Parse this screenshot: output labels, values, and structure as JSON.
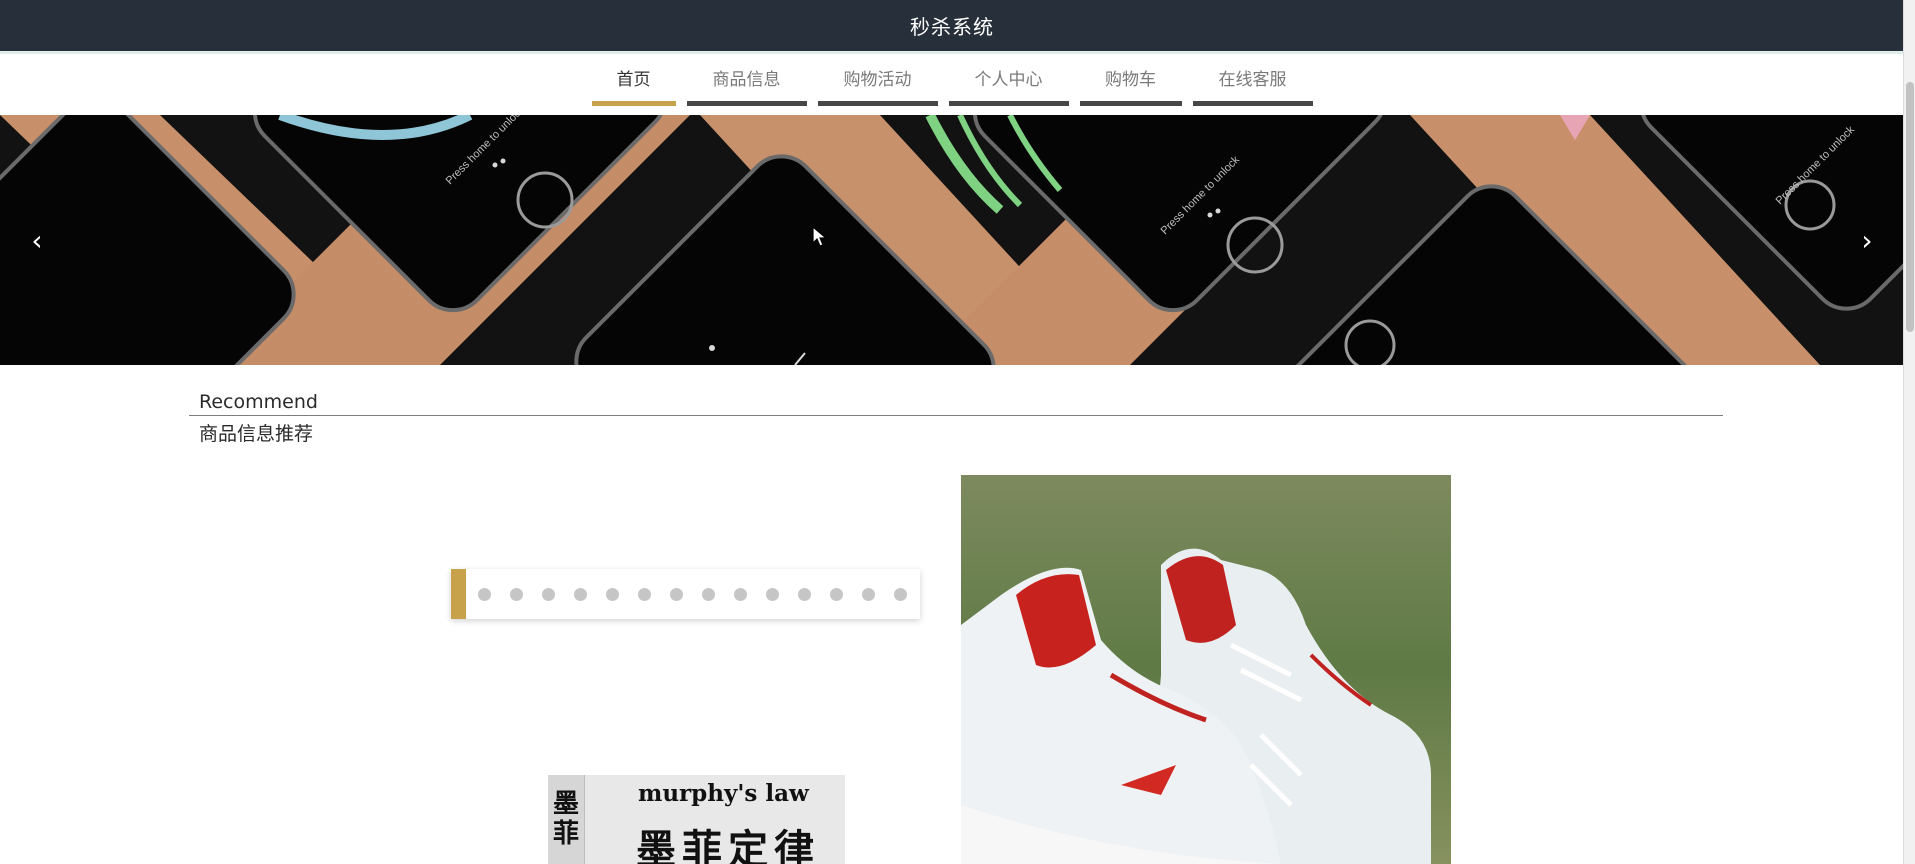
{
  "app": {
    "title": "秒杀系统"
  },
  "nav": {
    "items": [
      {
        "label": "首页",
        "active": true
      },
      {
        "label": "商品信息",
        "active": false
      },
      {
        "label": "购物活动",
        "active": false
      },
      {
        "label": "个人中心",
        "active": false
      },
      {
        "label": "购物车",
        "active": false
      },
      {
        "label": "在线客服",
        "active": false
      }
    ]
  },
  "banner": {
    "prev_icon": "‹",
    "next_icon": "›",
    "phone_lock_text": "Press home to unlock"
  },
  "recommend": {
    "title_en": "Recommend",
    "title_cn": "商品信息推荐"
  },
  "pager": {
    "dot_count": 14
  },
  "products": [
    {
      "name": "shoe",
      "image_icon": "sneaker-image"
    },
    {
      "name": "book",
      "image_icon": "book-image",
      "cover_en": "murphy's law",
      "cover_cn": "墨菲定律",
      "spine_text": "墨菲"
    }
  ],
  "colors": {
    "topbar": "#27303a",
    "accent": "#c8a24a",
    "nav_underline": "#474747"
  }
}
